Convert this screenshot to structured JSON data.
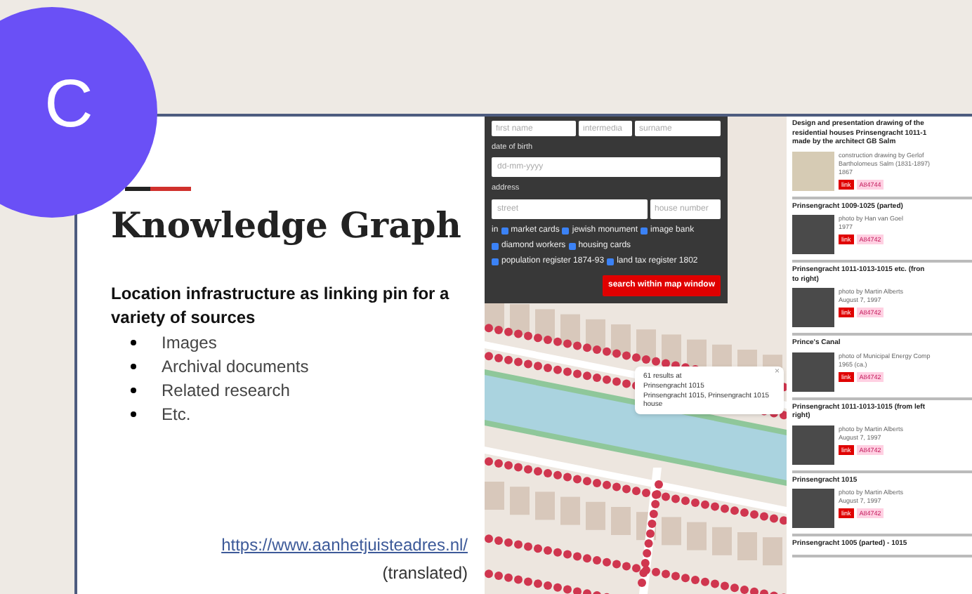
{
  "badge": "C",
  "slide": {
    "title": "Knowledge Graph",
    "subtitle": "Location infrastructure as linking pin for a variety of sources",
    "bullets": [
      "Images",
      "Archival documents",
      "Related research",
      "Etc."
    ],
    "link": "https://www.aanhetjuisteadres.nl/",
    "note": "(translated)"
  },
  "form": {
    "name_fields": [
      {
        "placeholder": "first name"
      },
      {
        "placeholder": "intermedia"
      },
      {
        "placeholder": "surname"
      }
    ],
    "dob_label": "date of birth",
    "dob": {
      "placeholder": "dd-mm-yyyy"
    },
    "address_label": "address",
    "street": {
      "placeholder": "street"
    },
    "house_number": {
      "placeholder": "house number"
    },
    "filter_prefix": "in",
    "filter_rows": [
      [
        {
          "label": "market cards",
          "checked": true
        },
        {
          "label": "jewish monument",
          "checked": true
        },
        {
          "label": "image bank",
          "checked": true
        }
      ],
      [
        {
          "label": "diamond workers",
          "checked": true
        },
        {
          "label": "housing cards",
          "checked": true
        }
      ],
      [
        {
          "label": "population register 1874-93",
          "checked": true
        },
        {
          "label": "land tax register 1802",
          "checked": true
        }
      ]
    ],
    "submit": "search within map window"
  },
  "popup": {
    "close": "×",
    "lines": [
      "61 results at",
      "Prinsengracht 1015",
      "Prinsengracht 1015, Prinsengracht 1015 house"
    ]
  },
  "results": [
    {
      "title_lines": [
        "Design and presentation drawing of the",
        "residential houses Prinsengracht 1011-1",
        "made by the architect GB Salm"
      ],
      "kind": "drawing",
      "caption": [
        "construction drawing by Gerlof",
        "Bartholomeus Salm (1831-1897)",
        "1867"
      ],
      "link": "link",
      "code": "A84744"
    },
    {
      "title_lines": [
        "Prinsengracht 1009-1025 (parted)"
      ],
      "kind": "photo",
      "caption": [
        "photo by Han van Goel",
        "1977"
      ],
      "link": "link",
      "code": "A84742"
    },
    {
      "title_lines": [
        "Prinsengracht 1011-1013-1015 etc. (fron",
        "to right)"
      ],
      "kind": "photo",
      "caption": [
        "photo by Martin Alberts",
        "August 7, 1997"
      ],
      "link": "link",
      "code": "A84742"
    },
    {
      "title_lines": [
        "Prince's Canal"
      ],
      "kind": "photo",
      "caption": [
        "photo of Municipal Energy Comp",
        "1965 (ca.)"
      ],
      "link": "link",
      "code": "A84742"
    },
    {
      "title_lines": [
        "Prinsengracht 1011-1013-1015 (from left",
        "right)"
      ],
      "kind": "photo",
      "caption": [
        "photo by Martin Alberts",
        "August 7, 1997"
      ],
      "link": "link",
      "code": "A84742"
    },
    {
      "title_lines": [
        "Prinsengracht 1015"
      ],
      "kind": "photo",
      "caption": [
        "photo by Martin Alberts",
        "August 7, 1997"
      ],
      "link": "link",
      "code": "A84742"
    },
    {
      "title_lines": [
        "Prinsengracht 1005 (parted) - 1015"
      ]
    }
  ]
}
